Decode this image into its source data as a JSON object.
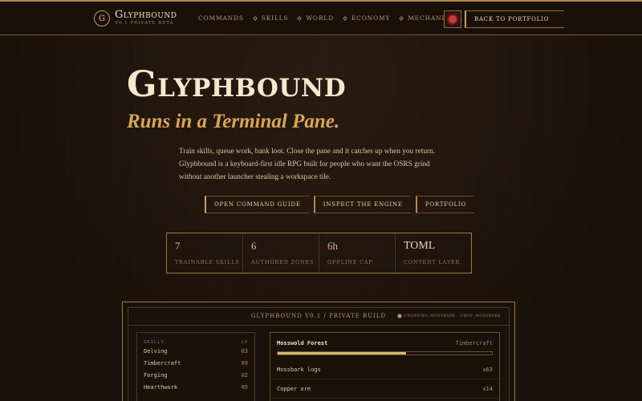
{
  "nav": {
    "brand_initial": "G",
    "brand_name": "Glyphbound",
    "brand_sub": "v0.1 private beta",
    "links": [
      "Commands",
      "Skills",
      "World",
      "Economy",
      "Mechanics"
    ],
    "back_label": "Back to Portfolio"
  },
  "hero": {
    "title": "Glyphbound",
    "subtitle": "Runs in a Terminal Pane.",
    "description": "Train skills, queue work, bank loot. Close the pane and it catches up when you return. Glyphbound is a keyboard-first idle RPG built for people who want the OSRS grind without another launcher stealing a workspace tile.",
    "cta": [
      "Open Command Guide",
      "Inspect the Engine",
      "Portfolio"
    ]
  },
  "stats": [
    {
      "value": "7",
      "label": "Trainable Skills"
    },
    {
      "value": "6",
      "label": "Authored Zones"
    },
    {
      "value": "6h",
      "label": "Offline Cap"
    },
    {
      "value": "TOML",
      "label": "Content Layer"
    }
  ],
  "terminal": {
    "title": "Glyphbound v0.1 / private build",
    "status": "chopping mossbark · chop_mossbark",
    "skills_header": "Skills",
    "lv_header": "Lv",
    "skills": [
      {
        "name": "Delving",
        "lv": "03"
      },
      {
        "name": "Timbercraft",
        "lv": "09"
      },
      {
        "name": "Forging",
        "lv": "02"
      },
      {
        "name": "Hearthwork",
        "lv": "05"
      }
    ],
    "zone": {
      "name": "Mosswold Forest",
      "skill": "Timbercraft",
      "progress": 0.6
    },
    "loot": [
      {
        "item": "Mossbark logs",
        "qty": "x63"
      },
      {
        "item": "Copper ore",
        "qty": "x14"
      }
    ]
  },
  "colors": {
    "accent": "#d6a856",
    "background": "#1c120b",
    "border": "#9c7a44",
    "status_red": "#c23a3a"
  }
}
